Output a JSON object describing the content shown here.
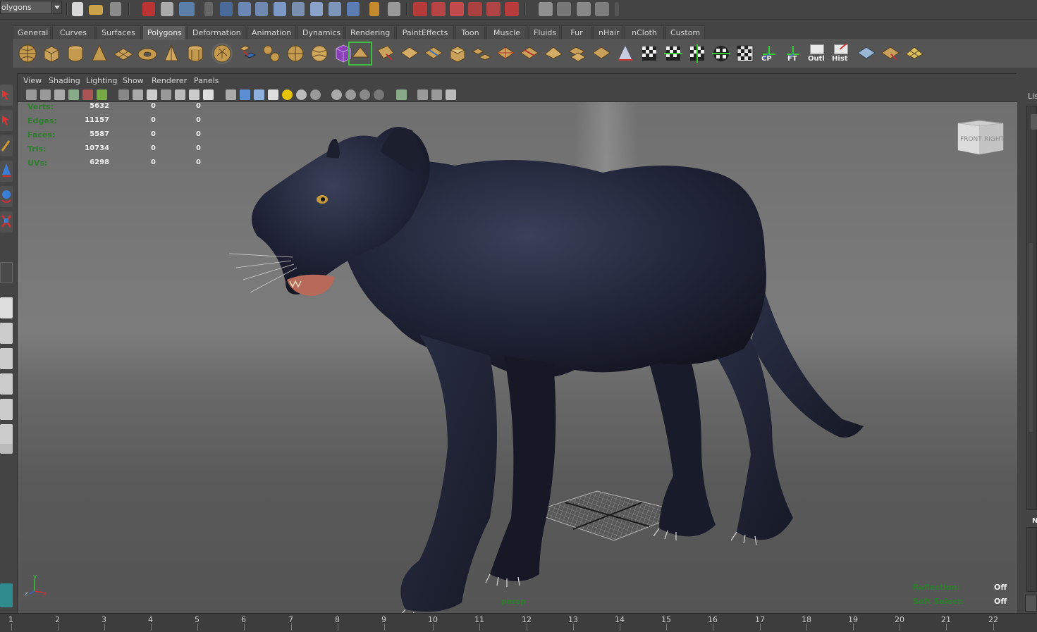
{
  "status_line": {
    "mode_select": "olygons"
  },
  "shelf": {
    "tabs": [
      "General",
      "Curves",
      "Surfaces",
      "Polygons",
      "Deformation",
      "Animation",
      "Dynamics",
      "Rendering",
      "PaintEffects",
      "Toon",
      "Muscle",
      "Fluids",
      "Fur",
      "nHair",
      "nCloth",
      "Custom"
    ],
    "active_tab": "Polygons",
    "text_buttons": {
      "cp": "CP",
      "ft": "FT",
      "outl": "Outl",
      "hist": "Hist"
    }
  },
  "panel": {
    "menus": [
      "View",
      "Shading",
      "Lighting",
      "Show",
      "Renderer",
      "Panels"
    ],
    "camera": "persp",
    "view_cube": {
      "front": "FRONT",
      "right": "RIGHT"
    },
    "axis": {
      "y": "y",
      "z": "z",
      "x": "x"
    }
  },
  "hud": {
    "poly_count": [
      {
        "label": "Verts:",
        "values": [
          "5632",
          "0",
          "0"
        ]
      },
      {
        "label": "Edges:",
        "values": [
          "11157",
          "0",
          "0"
        ]
      },
      {
        "label": "Faces:",
        "values": [
          "5587",
          "0",
          "0"
        ]
      },
      {
        "label": "Tris:",
        "values": [
          "10734",
          "0",
          "0"
        ]
      },
      {
        "label": "UVs:",
        "values": [
          "6298",
          "0",
          "0"
        ]
      }
    ],
    "reflection_label": "Reflection:",
    "reflection_value": "Off",
    "soft_select_label": "Soft Select:",
    "soft_select_value": "Off"
  },
  "right_panel": {
    "tab_label": "Lis",
    "letter": "N"
  },
  "timeline": {
    "ticks": [
      "1",
      "2",
      "3",
      "4",
      "5",
      "6",
      "7",
      "8",
      "9",
      "10",
      "11",
      "12",
      "13",
      "14",
      "15",
      "16",
      "17",
      "18",
      "19",
      "20",
      "21",
      "22"
    ]
  },
  "colors": {
    "hud_label": "#2e7d2e",
    "panther": "#1c1f2b",
    "background": "#444444"
  }
}
